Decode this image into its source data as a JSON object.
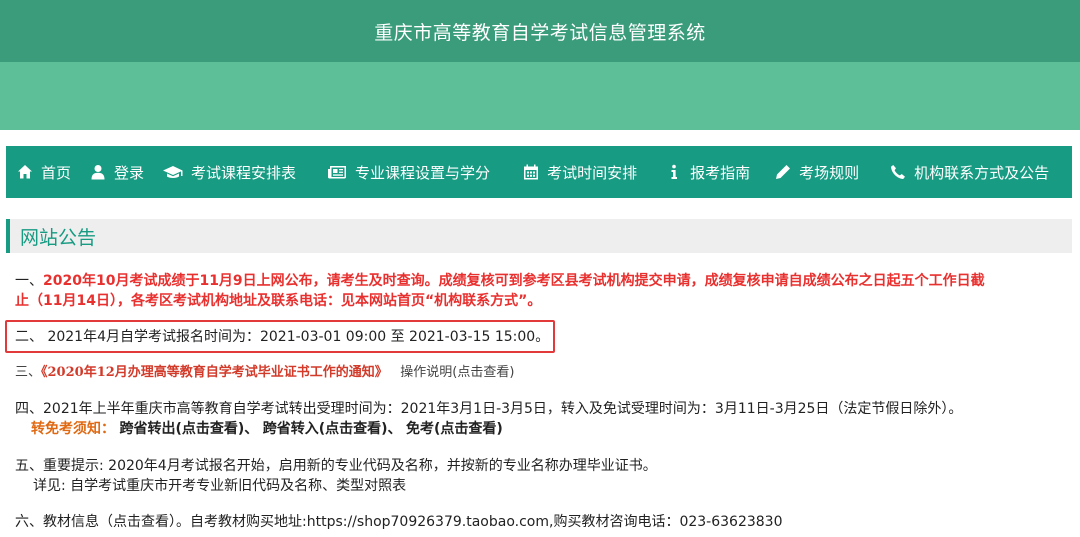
{
  "header": {
    "title": "重庆市高等教育自学考试信息管理系统"
  },
  "nav": [
    {
      "label": "首页",
      "icon": "home-icon"
    },
    {
      "label": "登录",
      "icon": "user-icon"
    },
    {
      "label": "考试课程安排表",
      "icon": "graduation-cap-icon"
    },
    {
      "label": "专业课程设置与学分",
      "icon": "newspaper-icon"
    },
    {
      "label": "考试时间安排",
      "icon": "calendar-icon"
    },
    {
      "label": "报考指南",
      "icon": "info-icon"
    },
    {
      "label": "考场规则",
      "icon": "pencil-icon"
    },
    {
      "label": "机构联系方式及公告",
      "icon": "phone-icon"
    }
  ],
  "notice": {
    "title": "网站公告",
    "item1": {
      "prefix": "一、",
      "text_line1": "2020年10月考试成绩于11月9日上网公布，请考生及时查询。成绩复核可到参考区县考试机构提交申请，成绩复核申请自成绩公布之日起五个工作日截",
      "text_line2": "止（11月14日），各考区考试机构地址及联系电话：见本网站首页“机构联系方式”。"
    },
    "item2": {
      "text": "二、 2021年4月自学考试报名时间为：2021-03-01 09:00 至 2021-03-15 15:00。"
    },
    "item3": {
      "prefix": "三、",
      "link": "《2020年12月办理高等教育自学考试毕业证书工作的通知》",
      "extra": "操作说明(点击查看)"
    },
    "item4": {
      "text": "四、2021年上半年重庆市高等教育自学考试转出受理时间为：2021年3月1日-3月5日，转入及免试受理时间为：3月11日-3月25日（法定节假日除外）。",
      "label": "转免考须知：",
      "link1": "跨省转出(点击查看)",
      "sep1": "、",
      "link2": "跨省转入(点击查看)",
      "sep2": "、",
      "link3": "免考(点击查看)"
    },
    "item5": {
      "text": "五、重要提示: 2020年4月考试报名开始，启用新的专业代码及名称，并按新的专业名称办理毕业证书。",
      "detail": "详见: 自学考试重庆市开考专业新旧代码及名称、类型对照表"
    },
    "item6": {
      "text": "六、教材信息（点击查看）。自考教材购买地址:https://shop70926379.taobao.com,购买教材咨询电话：023-63623830"
    }
  }
}
